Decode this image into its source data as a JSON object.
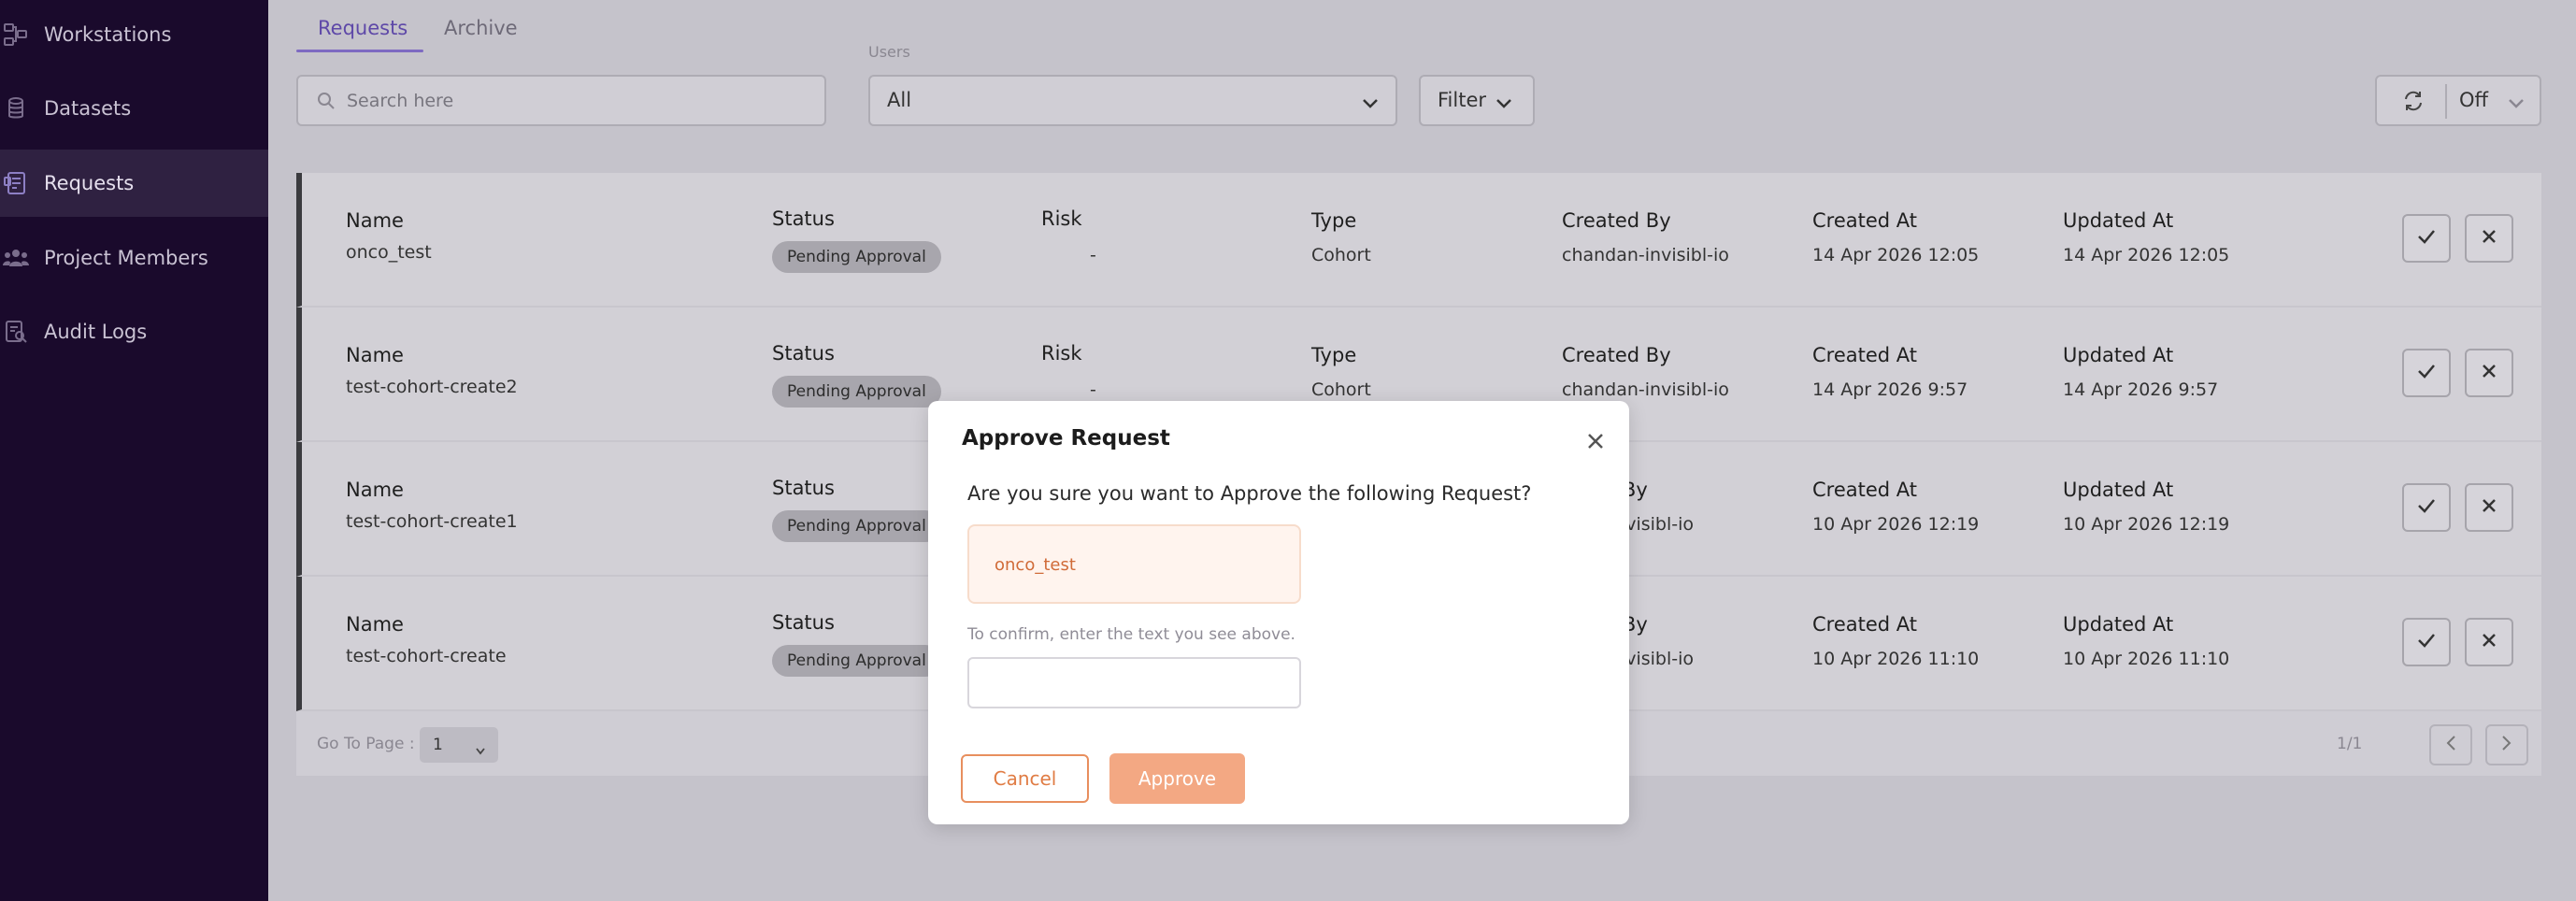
{
  "sidebar": {
    "items": [
      {
        "label": "Workstations",
        "icon": "workstation-icon",
        "active": false
      },
      {
        "label": "Datasets",
        "icon": "database-icon",
        "active": false
      },
      {
        "label": "Requests",
        "icon": "requests-icon",
        "active": true
      },
      {
        "label": "Project Members",
        "icon": "members-icon",
        "active": false
      },
      {
        "label": "Audit Logs",
        "icon": "audit-log-icon",
        "active": false
      }
    ]
  },
  "tabs": [
    {
      "label": "Requests",
      "active": true
    },
    {
      "label": "Archive",
      "active": false
    }
  ],
  "toolbar": {
    "search_placeholder": "Search here",
    "users_label": "Users",
    "users_value": "All",
    "filter_label": "Filter",
    "refresh_value": "Off"
  },
  "columns": {
    "name": "Name",
    "status": "Status",
    "risk": "Risk",
    "type": "Type",
    "created_by": "Created By",
    "created_at": "Created At",
    "updated_at": "Updated At"
  },
  "rows": [
    {
      "name": "onco_test",
      "status": "Pending Approval",
      "risk": "-",
      "type": "Cohort",
      "created_by": "chandan-invisibl-io",
      "created_at": "14 Apr 2026 12:05",
      "updated_at": "14 Apr 2026 12:05"
    },
    {
      "name": "test-cohort-create2",
      "status": "Pending Approval",
      "risk": "-",
      "type": "Cohort",
      "created_by": "chandan-invisibl-io",
      "created_at": "14 Apr 2026 9:57",
      "updated_at": "14 Apr 2026 9:57"
    },
    {
      "name": "test-cohort-create1",
      "status": "Pending Approval",
      "created_by_partial": "ed By",
      "created_by_value_partial": "n-invisibl-io",
      "created_at": "10 Apr 2026 12:19",
      "updated_at": "10 Apr 2026 12:19"
    },
    {
      "name": "test-cohort-create",
      "status": "Pending Approval",
      "created_by_partial": "ed By",
      "created_by_value_partial": "n-invisibl-io",
      "created_at": "10 Apr 2026 11:10",
      "updated_at": "10 Apr 2026 11:10"
    }
  ],
  "pagination": {
    "label": "Go To Page :",
    "current": "1",
    "count": "1/1"
  },
  "modal": {
    "title": "Approve Request",
    "question": "Are you sure you want to Approve the following Request?",
    "token": "onco_test",
    "hint": "To confirm, enter the text you see above.",
    "input_value": "",
    "cancel_label": "Cancel",
    "approve_label": "Approve"
  },
  "colors": {
    "sidebar_bg": "#1a0a2c",
    "accent": "#7e6ac2",
    "approve": "#f3a883",
    "cancel_border": "#e88f5e"
  }
}
